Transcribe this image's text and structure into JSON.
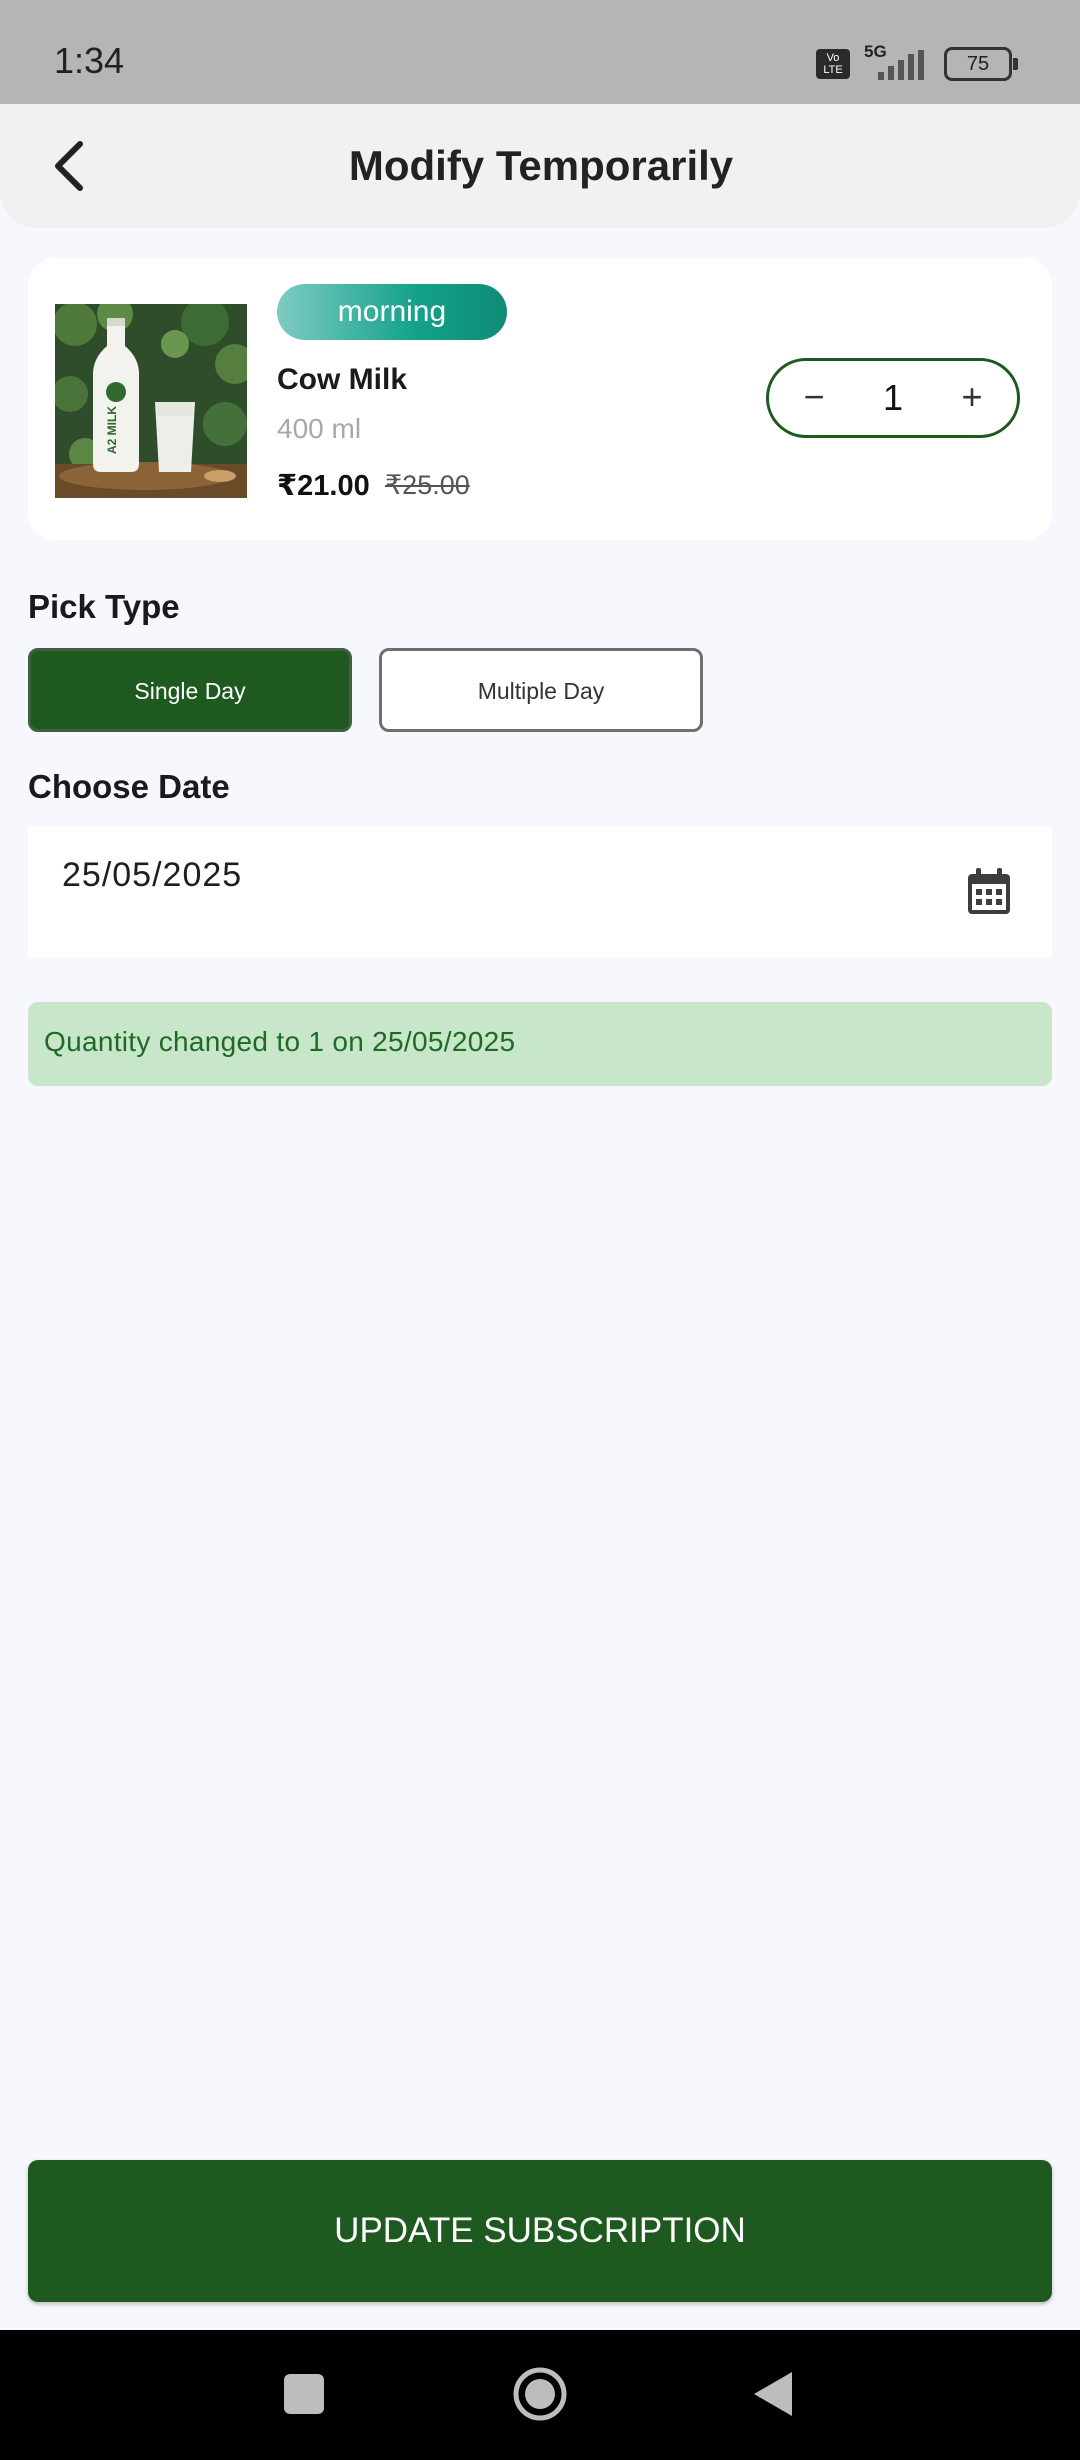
{
  "status_bar": {
    "time": "1:34",
    "volte_line1": "Vo",
    "volte_line2": "LTE",
    "network": "5G",
    "battery": "75"
  },
  "header": {
    "title": "Modify Temporarily"
  },
  "product": {
    "slot": "morning",
    "name": "Cow Milk",
    "size": "400 ml",
    "price": "₹21.00",
    "mrp": "₹25.00",
    "image_label": "A2 MILK",
    "quantity": "1",
    "minus_symbol": "−",
    "plus_symbol": "+"
  },
  "pick_type": {
    "label": "Pick Type",
    "options": [
      "Single Day",
      "Multiple Day"
    ],
    "selected": "Single Day"
  },
  "choose_date": {
    "label": "Choose Date",
    "value": "25/05/2025",
    "icon": "calendar-icon"
  },
  "notice": {
    "text": "Quantity changed to 1 on 25/05/2025"
  },
  "actions": {
    "update_label": "UPDATE SUBSCRIPTION"
  },
  "colors": {
    "primary": "#1e5a20",
    "notice_bg": "#c8e6c9",
    "pill_start": "#7fcbc2",
    "pill_end": "#0f8b76",
    "page_bg": "#f6f8fd"
  }
}
